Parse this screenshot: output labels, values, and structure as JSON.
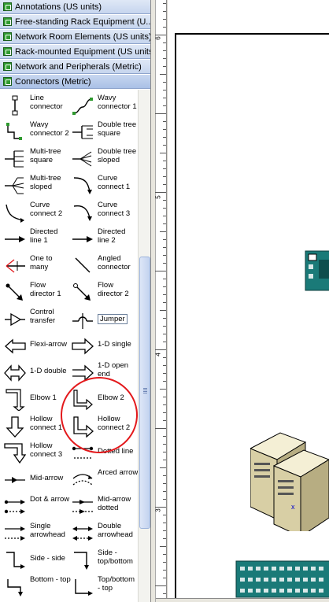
{
  "stencils": [
    {
      "label": "Annotations (US units)"
    },
    {
      "label": "Free-standing Rack Equipment (U..."
    },
    {
      "label": "Network Room Elements (US units)"
    },
    {
      "label": "Rack-mounted Equipment (US units)"
    },
    {
      "label": "Network and Peripherals (Metric)"
    },
    {
      "label": "Connectors (Metric)"
    }
  ],
  "shapes": [
    {
      "label": "Line connector",
      "icon": "line-connector-icon"
    },
    {
      "label": "Wavy connector 1",
      "icon": "wavy-connector-icon"
    },
    {
      "label": "Wavy connector 2",
      "icon": "wavy-connector-2-icon"
    },
    {
      "label": "Double tree square",
      "icon": "double-tree-square-icon"
    },
    {
      "label": "Multi-tree square",
      "icon": "multi-tree-square-icon"
    },
    {
      "label": "Double tree sloped",
      "icon": "double-tree-sloped-icon"
    },
    {
      "label": "Multi-tree sloped",
      "icon": "multi-tree-sloped-icon"
    },
    {
      "label": "Curve connect 1",
      "icon": "curve-connect-1-icon"
    },
    {
      "label": "Curve connect 2",
      "icon": "curve-connect-2-icon"
    },
    {
      "label": "Curve connect 3",
      "icon": "curve-connect-3-icon"
    },
    {
      "label": "Directed line 1",
      "icon": "directed-line-1-icon"
    },
    {
      "label": "Directed line 2",
      "icon": "directed-line-2-icon"
    },
    {
      "label": "One to many",
      "icon": "one-to-many-icon"
    },
    {
      "label": "Angled connector",
      "icon": "angled-connector-icon"
    },
    {
      "label": "Flow director 1",
      "icon": "flow-director-1-icon"
    },
    {
      "label": "Flow director 2",
      "icon": "flow-director-2-icon"
    },
    {
      "label": "Control transfer",
      "icon": "control-transfer-icon"
    },
    {
      "label": "Jumper",
      "icon": "jumper-icon"
    },
    {
      "label": "Flexi-arrow",
      "icon": "flexi-arrow-icon"
    },
    {
      "label": "1-D single",
      "icon": "one-d-single-icon"
    },
    {
      "label": "1-D double",
      "icon": "one-d-double-icon"
    },
    {
      "label": "1-D open end",
      "icon": "one-d-open-end-icon"
    },
    {
      "label": "Elbow 1",
      "icon": "elbow-1-icon"
    },
    {
      "label": "Elbow 2",
      "icon": "elbow-2-icon"
    },
    {
      "label": "Hollow connect 1",
      "icon": "hollow-connect-1-icon"
    },
    {
      "label": "Hollow connect 2",
      "icon": "hollow-connect-2-icon"
    },
    {
      "label": "Hollow connect 3",
      "icon": "hollow-connect-3-icon"
    },
    {
      "label": "Dotted line",
      "icon": "dotted-line-icon"
    },
    {
      "label": "Mid-arrow",
      "icon": "mid-arrow-icon"
    },
    {
      "label": "Arced arrow",
      "icon": "arced-arrow-icon"
    },
    {
      "label": "Dot & arrow",
      "icon": "dot-arrow-icon"
    },
    {
      "label": "Mid-arrow dotted",
      "icon": "mid-arrow-dotted-icon"
    },
    {
      "label": "Single arrowhead",
      "icon": "single-arrowhead-icon"
    },
    {
      "label": "Double arrowhead",
      "icon": "double-arrowhead-icon"
    },
    {
      "label": "Side - side",
      "icon": "side-side-icon"
    },
    {
      "label": "Side - top/bottom",
      "icon": "side-top-bottom-icon"
    },
    {
      "label": "Bottom - top",
      "icon": "bottom-top-icon"
    },
    {
      "label": "Top/bottom - top",
      "icon": "top-bottom-top-icon"
    }
  ],
  "ruler": {
    "labels": [
      "6",
      "5",
      "4",
      "3"
    ]
  },
  "colors": {
    "accent": "#2f9a2f",
    "highlight_circle": "#e3191c",
    "rack_teal": "#1a7a78"
  }
}
